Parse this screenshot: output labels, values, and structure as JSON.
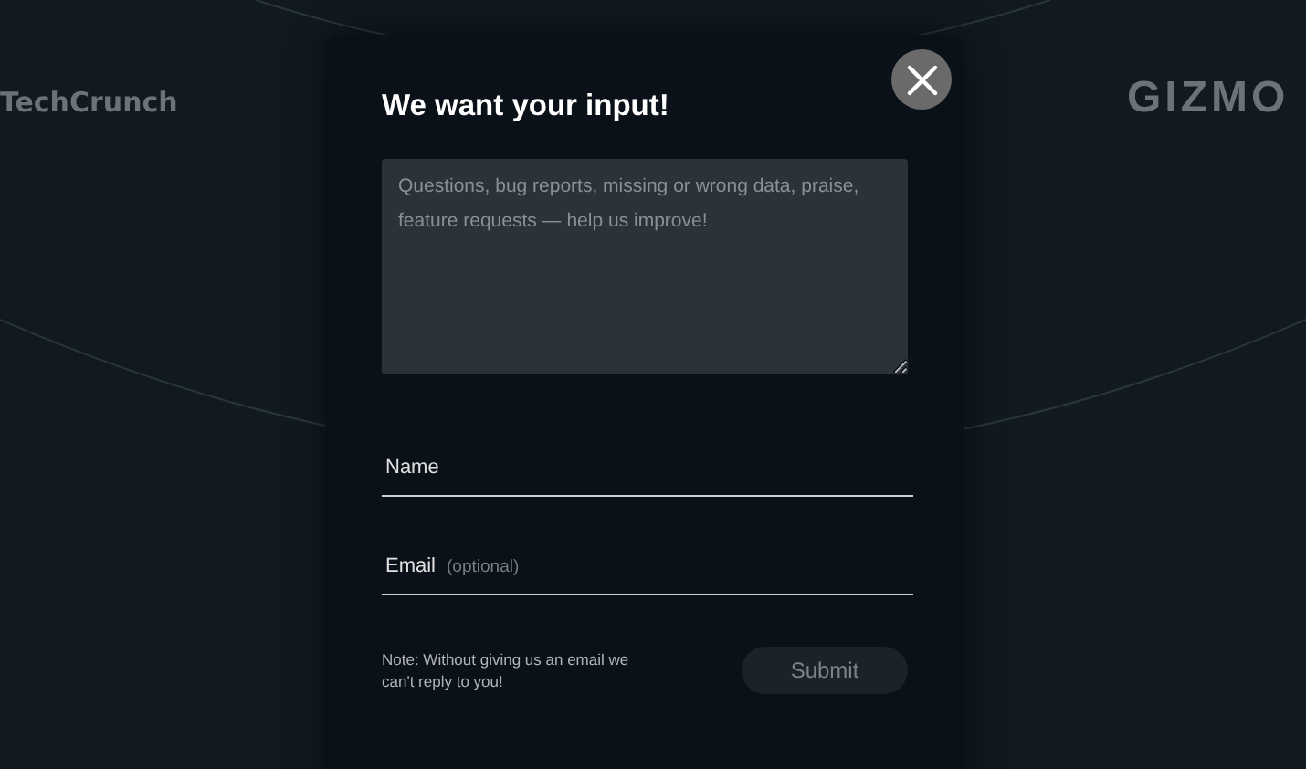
{
  "background": {
    "logos": [
      "TechCrunch",
      "GIZMO"
    ]
  },
  "dialog": {
    "title": "We want your input!",
    "message": {
      "placeholder": "Questions, bug reports, missing or wrong data, praise, feature requests — help us improve!"
    },
    "fields": [
      {
        "label": "Name"
      },
      {
        "label": "Email",
        "hint": "(optional)"
      }
    ],
    "note": "Note: Without giving us an email we can't reply to you!",
    "submit": {
      "label": "Submit",
      "disabled": true
    }
  }
}
